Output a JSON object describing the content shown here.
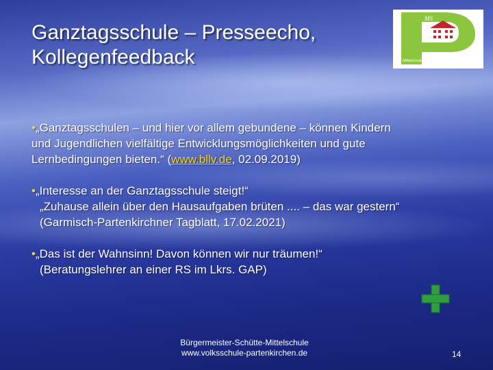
{
  "title": {
    "line1": "Ganztagsschule – Presseecho,",
    "line2": "Kollegenfeedback"
  },
  "logo": {
    "badge_text": "MS",
    "school_label": "Mittelschule Partenkirchen",
    "icon": "school-p-logo",
    "colors": {
      "green": "#8cc63f",
      "red": "#c0272d"
    }
  },
  "bullets": [
    {
      "marker": "•",
      "lines": [
        "„Ganztagsschulen – und hier vor allem gebundene – können Kindern",
        "und Jugendlichen vielfältige Entwicklungsmöglichkeiten und gute"
      ],
      "last_line_prefix": "Lernbedingungen bieten.“ (",
      "link_text": "www.bllv.de",
      "last_line_suffix": ", 02.09.2019)"
    },
    {
      "marker": "•",
      "lines": [
        "„Interesse an der Ganztagsschule steigt!“",
        "„Zuhause allein über den Hausaufgaben brüten .... – das war  gestern“",
        "(Garmisch-Partenkirchner Tagblatt, 17.02.2021)"
      ]
    },
    {
      "marker": "•",
      "lines": [
        "„Das ist der Wahnsinn! Davon können wir nur träumen!“",
        "(Beratungslehrer an einer RS im Lkrs. GAP)"
      ]
    }
  ],
  "plus_icon": {
    "name": "plus-icon",
    "color": "#2e9e3e"
  },
  "footer": {
    "line1": "Bürgermeister-Schütte-Mittelschule",
    "line2": "www.volksschule-partenkirchen.de"
  },
  "slide_number": "14"
}
